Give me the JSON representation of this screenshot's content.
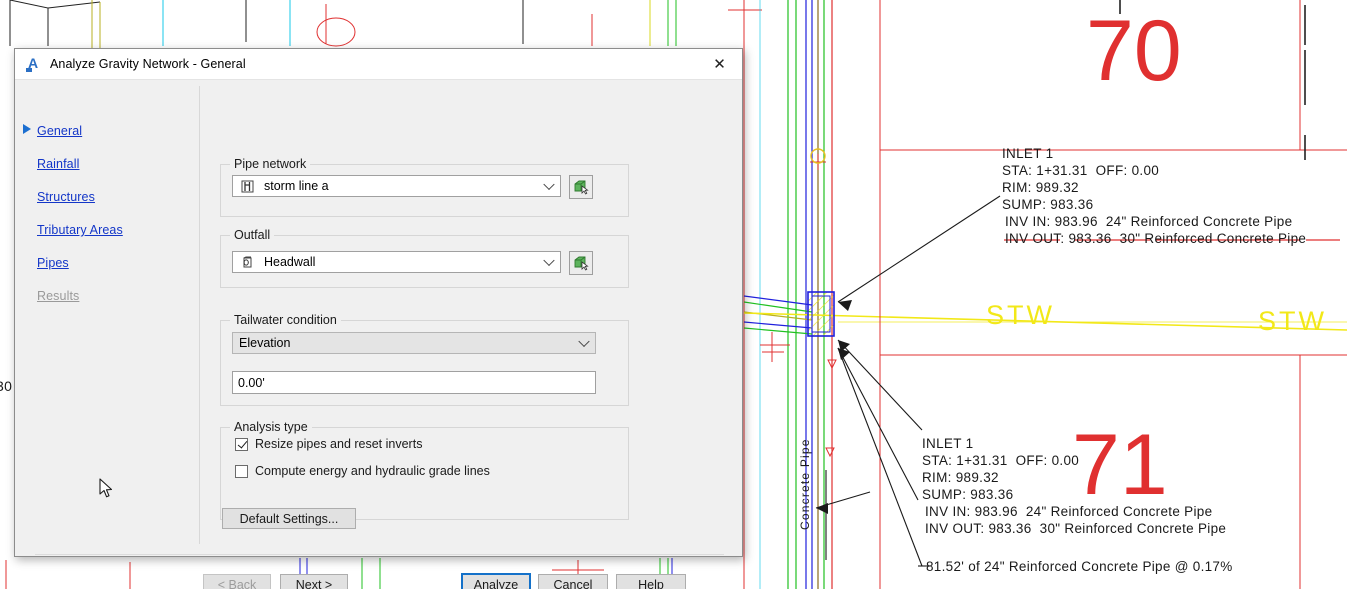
{
  "dialog": {
    "title": "Analyze Gravity Network - General",
    "app_icon": "autodesk-a-icon",
    "close_icon": "✕"
  },
  "nav": {
    "items": [
      {
        "label": "General",
        "active": true,
        "disabled": false
      },
      {
        "label": "Rainfall",
        "active": false,
        "disabled": false
      },
      {
        "label": "Structures",
        "active": false,
        "disabled": false
      },
      {
        "label": "Tributary Areas",
        "active": false,
        "disabled": false
      },
      {
        "label": "Pipes",
        "active": false,
        "disabled": false
      },
      {
        "label": "Results",
        "active": false,
        "disabled": true
      }
    ]
  },
  "groups": {
    "pipe_network": {
      "label": "Pipe network",
      "value": "storm line a",
      "icon": "pipe-network-icon",
      "pick_icon": "pick-object-icon"
    },
    "outfall": {
      "label": "Outfall",
      "value": "Headwall",
      "icon": "headwall-icon",
      "pick_icon": "pick-object-icon"
    },
    "tailwater": {
      "label": "Tailwater condition",
      "condition": "Elevation",
      "elevation_value": "0.00'"
    },
    "analysis_type": {
      "label": "Analysis type",
      "options": [
        {
          "label": "Resize pipes and reset inverts",
          "checked": true
        },
        {
          "label": "Compute energy and hydraulic grade lines",
          "checked": false
        }
      ]
    }
  },
  "buttons": {
    "default_settings": "Default Settings...",
    "back": "< Back",
    "next": "Next >",
    "analyze": "Analyze",
    "cancel": "Cancel",
    "help": "Help"
  },
  "colors": {
    "link": "#1336C8",
    "accent": "#1471C9",
    "dialog_bg": "#F0F0F0",
    "cad_red": "#E03030",
    "cad_yellow": "#F2E818",
    "cad_green": "#21C021",
    "cad_blue": "#2020DD"
  },
  "cad": {
    "label_1": {
      "line1": "INLET 1",
      "line2": "STA: 1+31.31  OFF: 0.00",
      "line3": "RIM: 989.32",
      "line4": "SUMP: 983.36",
      "line5": "INV IN: 983.96  24\" Reinforced Concrete Pipe",
      "line6": "INV OUT: 983.36  30\" Reinforced Concrete Pipe"
    },
    "label_2": {
      "line1": "INLET 1",
      "line2": "STA: 1+31.31  OFF: 0.00",
      "line3": "RIM: 989.32",
      "line4": "SUMP: 983.36",
      "line5": "INV IN: 983.96  24\" Reinforced Concrete Pipe",
      "line6": "INV OUT: 983.36  30\" Reinforced Concrete Pipe"
    },
    "pipe_note": "81.52' of 24\" Reinforced Concrete Pipe @ 0.17%",
    "pipe_vertical_label": "Concrete Pipe",
    "parcel_number_70": "70",
    "parcel_number_71": "71",
    "stw_label_left": "STW",
    "stw_label_right": "STW",
    "edge_text": "30"
  }
}
